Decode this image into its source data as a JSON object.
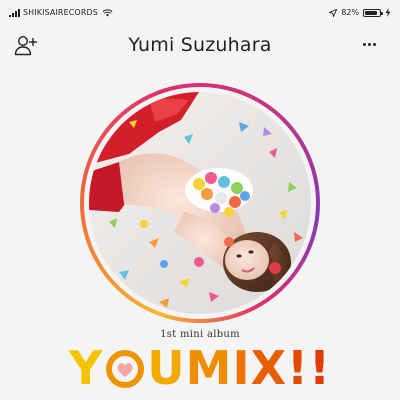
{
  "status_bar": {
    "carrier": "SHIKISAIRECORDS",
    "battery_percent": "82%",
    "battery_level": 0.82,
    "icons": [
      "signal-icon",
      "wifi-icon",
      "location-icon",
      "battery-icon",
      "charging-bolt-icon"
    ]
  },
  "header": {
    "name": "Yumi Suzuhara",
    "left_icon": "add-user-icon",
    "right_icon": "more-icon"
  },
  "album": {
    "subtitle": "1st mini album",
    "title_letters": [
      "Y",
      "U",
      "M",
      "I",
      "X",
      "!",
      "!"
    ],
    "title_colors": [
      "#f5c400",
      "#f2a900",
      "#ef8c00",
      "#ec7400",
      "#e85d00",
      "#e44a00",
      "#e03a00"
    ],
    "heart_color": "#f4a7a0"
  },
  "colors": {
    "ring_gradient": [
      "#f7b733",
      "#f37335",
      "#e1306c",
      "#c13584",
      "#833ab4"
    ],
    "background": "#f4f4f4"
  }
}
